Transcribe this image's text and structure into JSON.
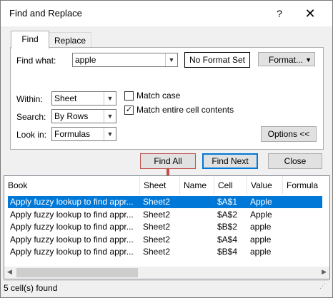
{
  "window": {
    "title": "Find and Replace",
    "help_glyph": "?",
    "close_glyph": "✕"
  },
  "tabs": [
    {
      "label": "Find",
      "active": true
    },
    {
      "label": "Replace",
      "active": false
    }
  ],
  "find_what": {
    "label": "Find what:",
    "value": "apple"
  },
  "format_status": {
    "label": "No Format Set"
  },
  "format_button": {
    "label": "Format..."
  },
  "within": {
    "label": "Within:",
    "value": "Sheet"
  },
  "search": {
    "label": "Search:",
    "value": "By Rows"
  },
  "look_in": {
    "label": "Look in:",
    "value": "Formulas"
  },
  "match_case": {
    "label": "Match case",
    "checked": false
  },
  "match_entire": {
    "label": "Match entire cell contents",
    "checked": true
  },
  "options_button": {
    "label": "Options <<"
  },
  "buttons": {
    "find_all": "Find All",
    "find_next": "Find Next",
    "close": "Close"
  },
  "results": {
    "columns": [
      "Book",
      "Sheet",
      "Name",
      "Cell",
      "Value",
      "Formula"
    ],
    "rows": [
      {
        "book": "Apply fuzzy lookup to find appr...",
        "sheet": "Sheet2",
        "name": "",
        "cell": "$A$1",
        "value": "Apple",
        "formula": "",
        "selected": true
      },
      {
        "book": "Apply fuzzy lookup to find appr...",
        "sheet": "Sheet2",
        "name": "",
        "cell": "$A$2",
        "value": "Apple",
        "formula": "",
        "selected": false
      },
      {
        "book": "Apply fuzzy lookup to find appr...",
        "sheet": "Sheet2",
        "name": "",
        "cell": "$B$2",
        "value": "apple",
        "formula": "",
        "selected": false
      },
      {
        "book": "Apply fuzzy lookup to find appr...",
        "sheet": "Sheet2",
        "name": "",
        "cell": "$A$4",
        "value": "apple",
        "formula": "",
        "selected": false
      },
      {
        "book": "Apply fuzzy lookup to find appr...",
        "sheet": "Sheet2",
        "name": "",
        "cell": "$B$4",
        "value": "apple",
        "formula": "",
        "selected": false
      }
    ]
  },
  "status": {
    "text": "5 cell(s) found"
  },
  "colors": {
    "selection": "#0078d7",
    "find_all_highlight": "#c0504d",
    "focus_border": "#0078d7"
  }
}
